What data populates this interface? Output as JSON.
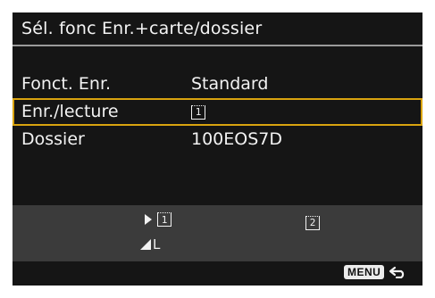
{
  "screen": {
    "title": "Sél. fonc Enr.+carte/dossier"
  },
  "rows": [
    {
      "label": "Fonct. Enr.",
      "value": "Standard"
    },
    {
      "label": "Enr./lecture",
      "value_icon_text": "1"
    },
    {
      "label": "Dossier",
      "value": "100EOS7D"
    }
  ],
  "status_panel": {
    "card1_text": "1",
    "card2_text": "2",
    "quality_text": "L"
  },
  "footer": {
    "menu_label": "MENU"
  },
  "colors": {
    "background": "#151515",
    "selection_border": "#d9a30f",
    "panel": "#3b3b3b",
    "text": "#f2f2f2"
  },
  "icons": {
    "card": "memory-card-icon",
    "play": "play-icon",
    "quality": "image-quality-icon",
    "back": "return-arrow-icon"
  }
}
